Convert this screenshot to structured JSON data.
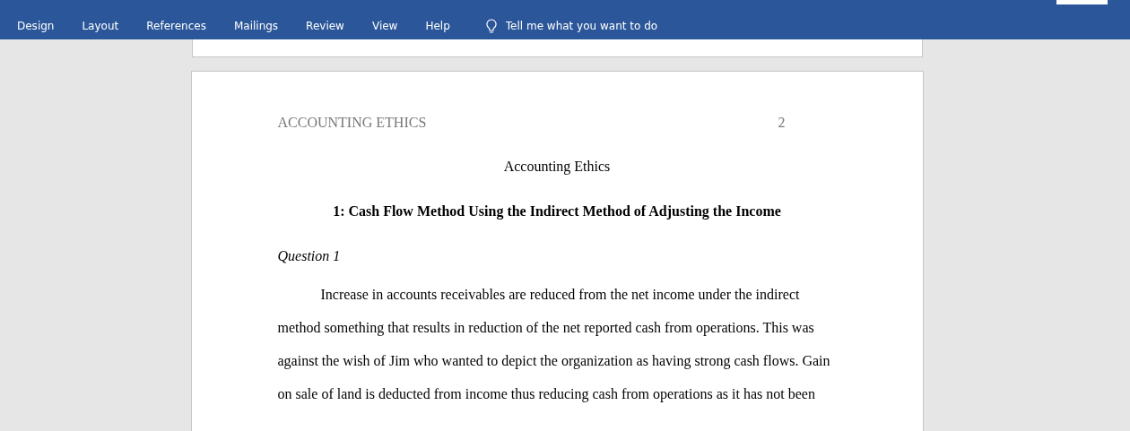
{
  "ribbon": {
    "tabs": [
      {
        "label": "Design"
      },
      {
        "label": "Layout"
      },
      {
        "label": "References"
      },
      {
        "label": "Mailings"
      },
      {
        "label": "Review"
      },
      {
        "label": "View"
      },
      {
        "label": "Help"
      }
    ],
    "tell_me": {
      "placeholder": "Tell me what you want to do"
    }
  },
  "document": {
    "header": {
      "title": "ACCOUNTING ETHICS",
      "page_number": "2"
    },
    "title": "Accounting Ethics",
    "heading": "1: Cash Flow Method Using the Indirect Method of Adjusting the Income",
    "subheading": "Question 1",
    "paragraph": "Increase in accounts receivables are reduced from the net income under the indirect method something that results in reduction of the net reported cash from operations. This was against the wish of Jim who wanted to depict the organization as having strong cash flows. Gain on sale of land is deducted from income thus reducing cash from operations as it has not been"
  }
}
